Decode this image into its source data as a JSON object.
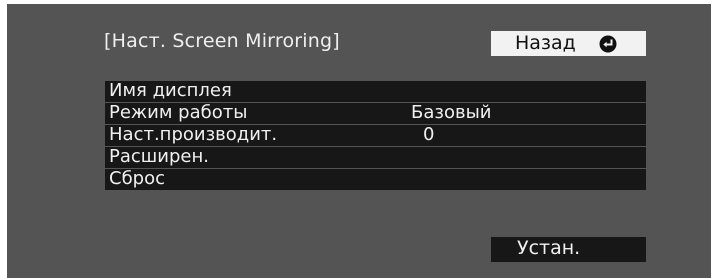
{
  "header": {
    "title": "[Наст. Screen Mirroring]",
    "back_label": "Назад",
    "back_icon": "enter-icon"
  },
  "menu": {
    "items": [
      {
        "label": "Имя дисплея",
        "value": ""
      },
      {
        "label": "Режим работы",
        "value": "Базовый"
      },
      {
        "label": "Наст.производит.",
        "value": "0"
      },
      {
        "label": "Расширен.",
        "value": ""
      },
      {
        "label": "Сброс",
        "value": ""
      }
    ]
  },
  "footer": {
    "set_label": "Устан."
  },
  "colors": {
    "panel_bg": "#545454",
    "row_bg": "#171717",
    "button_light": "#f2f2f2",
    "text_light": "#f0f0f0",
    "text_dark": "#111111"
  }
}
